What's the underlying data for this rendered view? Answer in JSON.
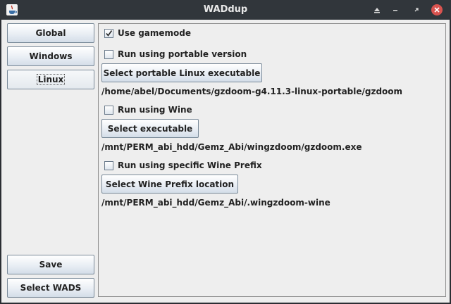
{
  "window": {
    "title": "WADdup",
    "controls": [
      "minimize-up-icon",
      "minimize-icon",
      "restore-icon",
      "close-icon"
    ]
  },
  "sidebar": {
    "top_buttons": [
      {
        "label": "Global"
      },
      {
        "label": "Windows"
      },
      {
        "label": "Linux",
        "selected": true
      }
    ],
    "bottom_buttons": [
      {
        "label": "Save"
      },
      {
        "label": "Select WADS"
      }
    ]
  },
  "linux_panel": {
    "use_gamemode": {
      "label": "Use gamemode",
      "checked": true
    },
    "portable": {
      "label": "Run using portable version",
      "checked": false,
      "button_label": "Select portable Linux executable",
      "path": "/home/abel/Documents/gzdoom-g4.11.3-linux-portable/gzdoom"
    },
    "wine": {
      "label": "Run using Wine",
      "checked": false,
      "button_label": "Select executable",
      "path": "/mnt/PERM_abi_hdd/Gemz_Abi/wingzdoom/gzdoom.exe"
    },
    "wine_prefix": {
      "label": "Run using specific Wine Prefix",
      "checked": false,
      "button_label": "Select Wine Prefix location",
      "path": "/mnt/PERM_abi_hdd/Gemz_Abi/.wingzdoom-wine"
    }
  },
  "colors": {
    "titlebar_bg": "#31363b",
    "window_bg": "#eeeeee",
    "close_button": "#d9534f"
  }
}
